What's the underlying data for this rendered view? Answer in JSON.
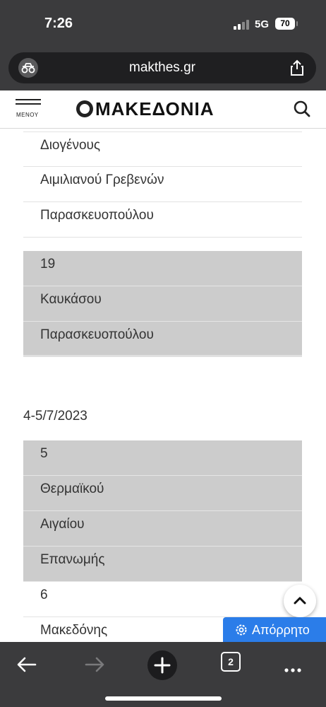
{
  "status_bar": {
    "time": "7:26",
    "network": "5G",
    "battery": "70"
  },
  "browser": {
    "url": "makthes.gr"
  },
  "site": {
    "menu_label": "ΜΕΝΟΥ",
    "logo_text": "ΜΑΚΕΔΟΝΙΑ"
  },
  "tables": [
    {
      "rows": [
        "Διογένους",
        "Αιμιλιανού Γρεβενών",
        "Παρασκευοπούλου"
      ]
    },
    {
      "rows": [
        "19",
        "Καυκάσου",
        "Παρασκευοπούλου"
      ]
    }
  ],
  "date_heading": "4-5/7/2023",
  "tables2": [
    {
      "rows": [
        "5",
        "Θερμαϊκού",
        "Αιγαίου",
        "Επανωμής"
      ]
    },
    {
      "rows": [
        "6",
        "Μακεδόνης"
      ]
    }
  ],
  "privacy_button": "Απόρρητο",
  "tab_count": "2",
  "colors": {
    "chrome": "#3b3b3d",
    "row_gray": "#cccccc",
    "privacy_blue": "#2b7de9"
  }
}
